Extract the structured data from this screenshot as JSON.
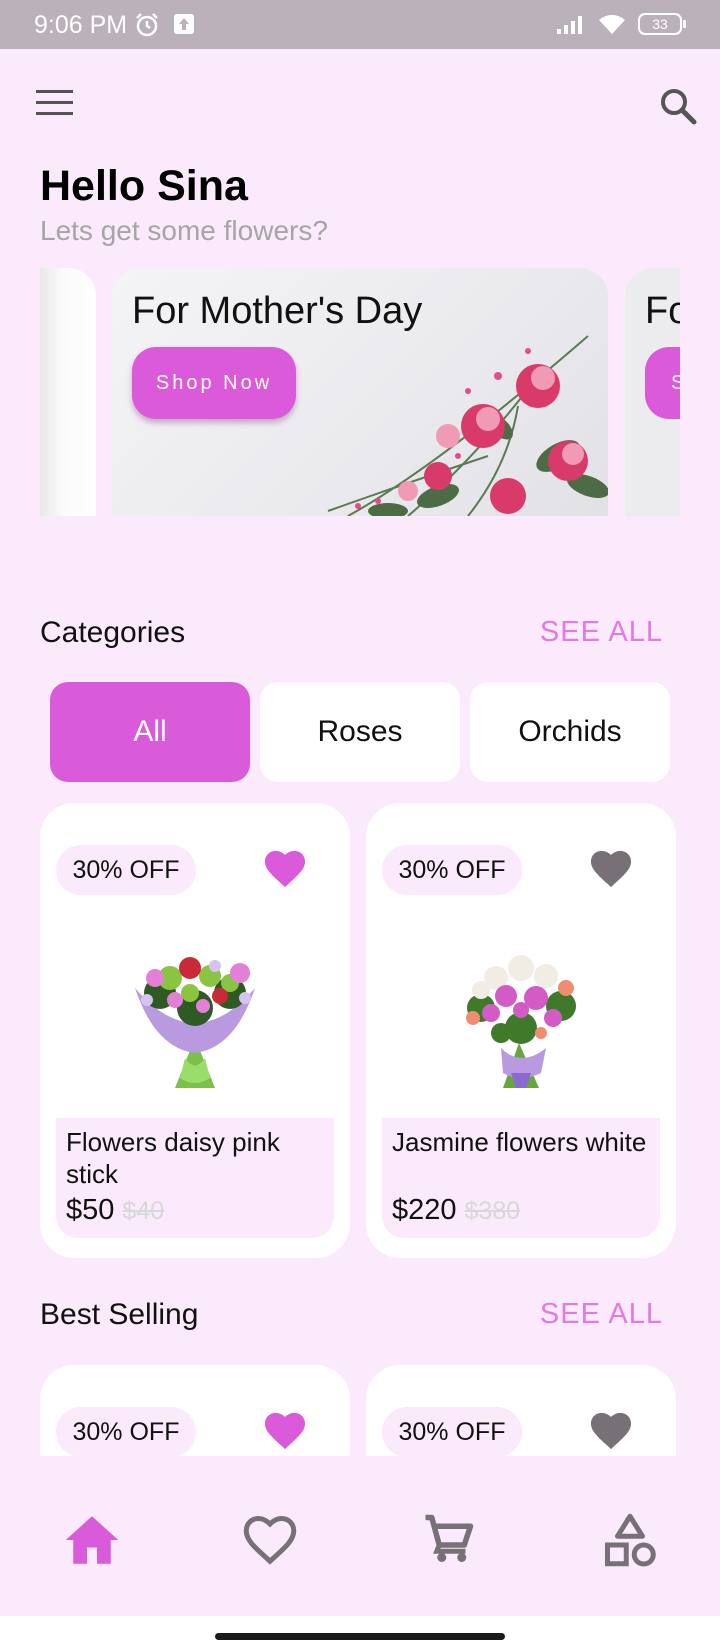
{
  "status_bar": {
    "time": "9:06 PM",
    "battery": "33"
  },
  "header": {
    "greeting": "Hello Sina",
    "subtitle": "Lets get some flowers?"
  },
  "banners": [
    {
      "title": "For Mother's Day",
      "button": "Shop Now"
    },
    {
      "title": "Fo",
      "button": "S"
    }
  ],
  "categories": {
    "title": "Categories",
    "see_all": "SEE ALL",
    "chips": [
      "All",
      "Roses",
      "Orchids"
    ],
    "active": "All"
  },
  "products": [
    {
      "badge": "30% OFF",
      "name": "Flowers daisy pink stick",
      "price": "$50",
      "old_price": "$40",
      "favorited": true
    },
    {
      "badge": "30% OFF",
      "name": "Jasmine flowers white",
      "price": "$220",
      "old_price": "$380",
      "favorited": false
    }
  ],
  "best_selling": {
    "title": "Best Selling",
    "see_all": "SEE ALL",
    "products": [
      {
        "badge": "30% OFF",
        "favorited": true
      },
      {
        "badge": "30% OFF",
        "favorited": false
      }
    ]
  },
  "bottom_nav": [
    "home-icon",
    "heart-icon",
    "cart-icon",
    "shapes-icon"
  ],
  "colors": {
    "accent": "#d95bd9",
    "background": "#fbeafb",
    "icon_inactive": "#777177"
  }
}
